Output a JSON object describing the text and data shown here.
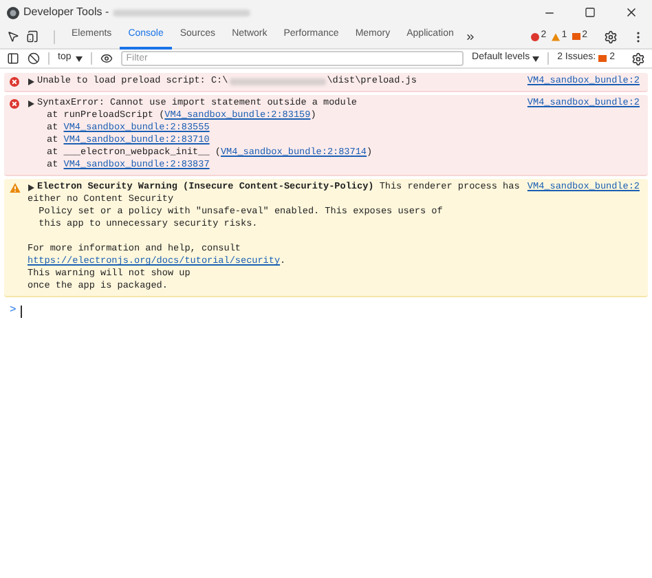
{
  "window": {
    "title": "Developer Tools -"
  },
  "tabs": [
    {
      "label": "Elements",
      "selected": false
    },
    {
      "label": "Console",
      "selected": true
    },
    {
      "label": "Sources",
      "selected": false
    },
    {
      "label": "Network",
      "selected": false
    },
    {
      "label": "Performance",
      "selected": false
    },
    {
      "label": "Memory",
      "selected": false
    },
    {
      "label": "Application",
      "selected": false
    }
  ],
  "counts": {
    "errors": "2",
    "warnings": "1",
    "issues": "2"
  },
  "toolbar": {
    "context": "top",
    "filter_placeholder": "Filter",
    "levels": "Default levels",
    "issues_label": "2 Issues:",
    "issues_count": "2"
  },
  "messages": [
    {
      "kind": "error",
      "expanded": false,
      "head": "Unable to load preload script: C:\\",
      "head_tail": "\\dist\\preload.js",
      "redacted": true,
      "source": "VM4_sandbox_bundle:2"
    },
    {
      "kind": "error",
      "expanded": false,
      "head": "SyntaxError: Cannot use import statement outside a module",
      "source": "VM4_sandbox_bundle:2",
      "stack": [
        {
          "before": "at runPreloadScript (",
          "link": "VM4_sandbox_bundle:2:83159",
          "after": ")"
        },
        {
          "before": "at ",
          "link": "VM4_sandbox_bundle:2:83555"
        },
        {
          "before": "at ",
          "link": "VM4_sandbox_bundle:2:83710"
        },
        {
          "before": "at ___electron_webpack_init__ (",
          "link": "VM4_sandbox_bundle:2:83714",
          "after": ")"
        },
        {
          "before": "at ",
          "link": "VM4_sandbox_bundle:2:83837"
        }
      ]
    },
    {
      "kind": "warning",
      "expanded": false,
      "head": "**Electron Security Warning (Insecure Content-Security-Policy)** This renderer process has",
      "source": "VM4_sandbox_bundle:2",
      "paragraphs": [
        [
          "either no Content Security",
          "  Policy set or a policy with \"unsafe-eval\" enabled. This exposes users of",
          "  this app to unnecessary security risks."
        ],
        [
          "For more information and help, consult",
          {
            "link": "https://electronjs.org/docs/tutorial/security",
            "after": "."
          },
          "This warning will not show up",
          "once the app is packaged."
        ]
      ]
    }
  ],
  "prompt": ">"
}
